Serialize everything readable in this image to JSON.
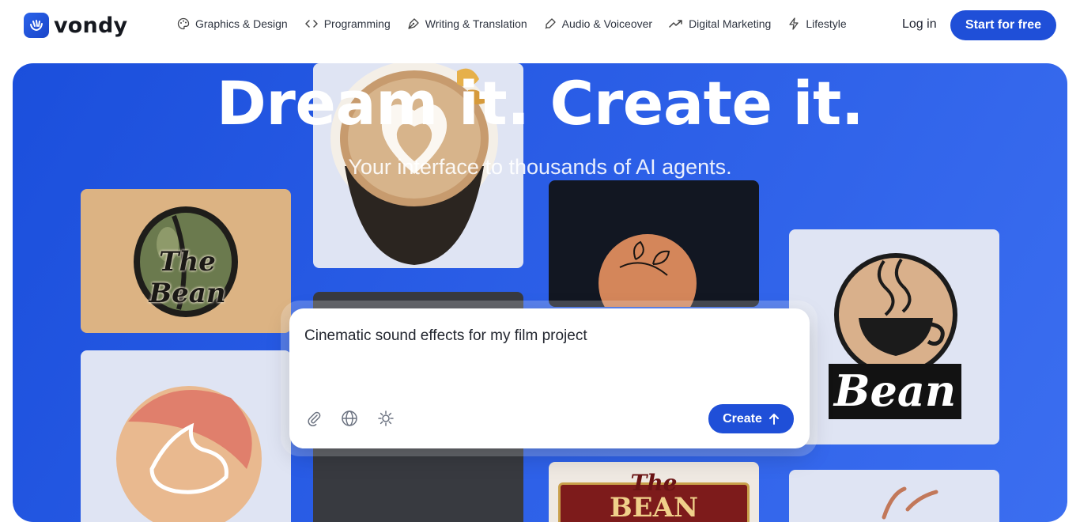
{
  "brand": {
    "name": "vondy",
    "logo_icon": "shaka-hand-icon",
    "accent": "#1f4fd8"
  },
  "nav": {
    "items": [
      {
        "label": "Graphics & Design",
        "icon": "palette-icon"
      },
      {
        "label": "Programming",
        "icon": "code-icon"
      },
      {
        "label": "Writing & Translation",
        "icon": "pen-nib-icon"
      },
      {
        "label": "Audio & Voiceover",
        "icon": "microphone-icon"
      },
      {
        "label": "Digital Marketing",
        "icon": "trending-up-icon"
      },
      {
        "label": "Lifestyle",
        "icon": "lightning-icon"
      }
    ],
    "login": "Log in",
    "start": "Start for free"
  },
  "hero": {
    "title": "Dream it. Create it.",
    "subtitle": "Your interface to thousands of AI agents.",
    "gallery": {
      "bean_logo_text": "The Bean",
      "cup_logo_text": "Bean",
      "sign_logo_text": "The",
      "sign_logo_text2": "BEAN"
    }
  },
  "prompt": {
    "value": "Cinematic sound effects for my film project",
    "tools": [
      "paperclip-icon",
      "globe-icon",
      "sun-icon"
    ],
    "create_label": "Create"
  }
}
